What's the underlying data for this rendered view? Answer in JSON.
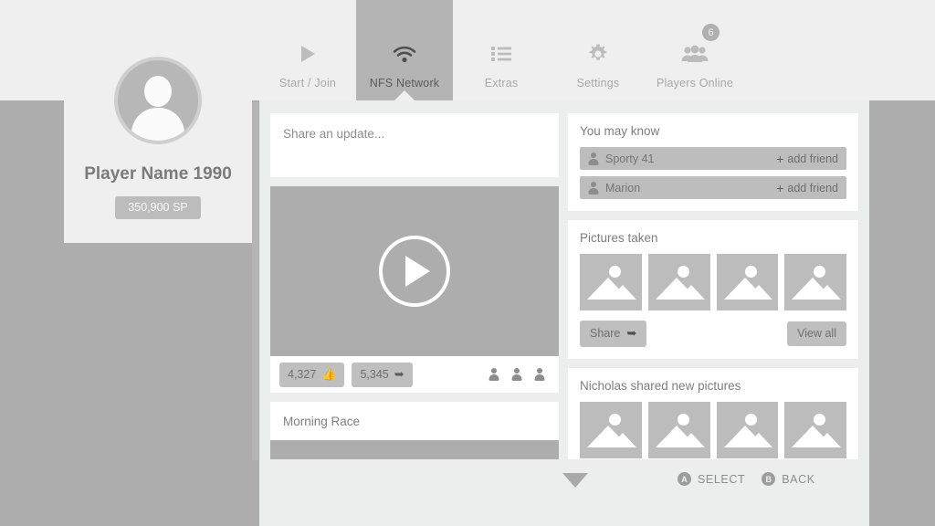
{
  "nav": {
    "items": [
      {
        "label": "Start / Join",
        "icon": "play-icon",
        "active": false,
        "badge": null
      },
      {
        "label": "NFS Network",
        "icon": "wifi-icon",
        "active": true,
        "badge": null
      },
      {
        "label": "Extras",
        "icon": "list-icon",
        "active": false,
        "badge": null
      },
      {
        "label": "Settings",
        "icon": "gear-icon",
        "active": false,
        "badge": null
      },
      {
        "label": "Players Online",
        "icon": "people-icon",
        "active": false,
        "badge": "6"
      }
    ]
  },
  "profile": {
    "avatar_icon": "person-avatar-icon",
    "name": "Player Name 1990",
    "points": "350,900 SP"
  },
  "feed": {
    "composer": {
      "placeholder": "Share an update...",
      "value": ""
    },
    "video_post": {
      "play_icon": "play-circle-icon",
      "likes": "4,327",
      "likes_icon": "thumbs-up-icon",
      "shares": "5,345",
      "shares_icon": "share-arrow-icon",
      "viewers_icon": "person-icon",
      "viewer_count": 3
    },
    "next_post": {
      "title": "Morning Race"
    }
  },
  "sidebar_cards": {
    "you_may_know": {
      "title": "You may know",
      "add_label": "add friend",
      "add_icon": "plus-icon",
      "person_icon": "person-icon",
      "people": [
        {
          "name": "Sporty 41"
        },
        {
          "name": "Marion"
        }
      ]
    },
    "pictures_taken": {
      "title": "Pictures taken",
      "thumb_icon": "image-placeholder-icon",
      "thumb_count": 4,
      "share_label": "Share",
      "share_icon": "share-arrow-icon",
      "view_all_label": "View all"
    },
    "shared_pictures": {
      "title": "Nicholas shared new pictures",
      "thumb_icon": "image-placeholder-icon",
      "thumb_count": 4
    }
  },
  "footer": {
    "scroll_down_icon": "chevron-down-icon",
    "prompts": [
      {
        "button": "A",
        "label": "SELECT"
      },
      {
        "button": "B",
        "label": "BACK"
      }
    ]
  },
  "colors": {
    "page_bg": "#efefef",
    "slab_gray": "#adadad",
    "content_bg": "#eceded",
    "card_bg": "#ffffff",
    "active_tab": "#b4b4b4",
    "pill_gray": "#bfbfbf",
    "text_muted": "#8e8e8e",
    "text_strong": "#7b7b7b"
  }
}
